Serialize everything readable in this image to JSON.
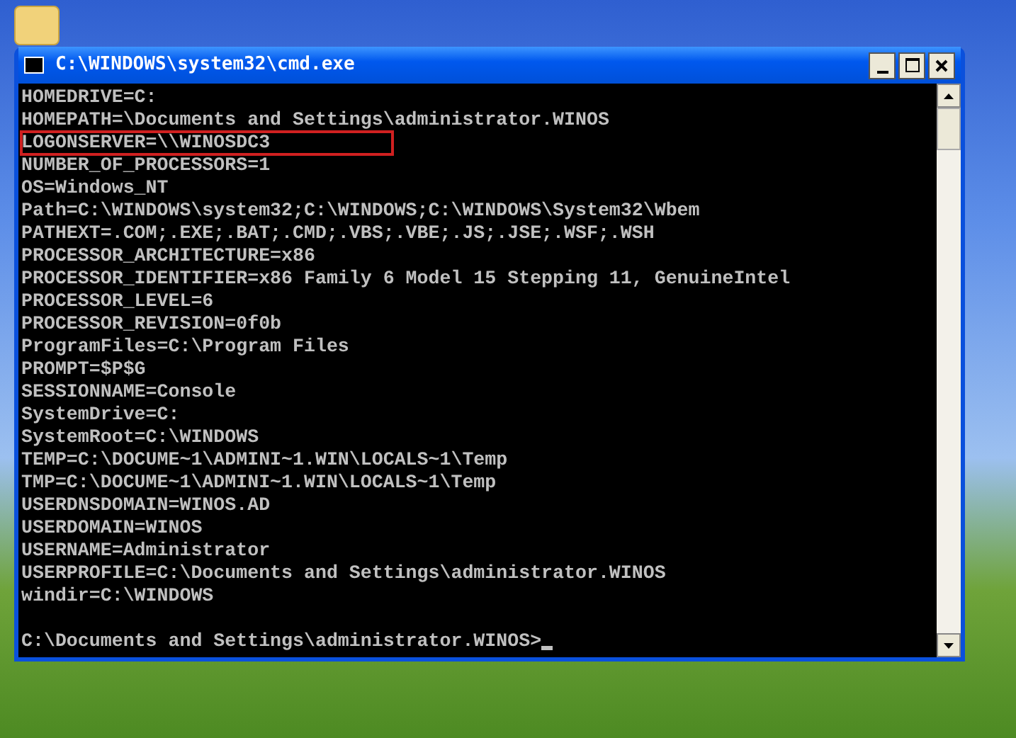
{
  "window": {
    "title": "C:\\WINDOWS\\system32\\cmd.exe"
  },
  "console": {
    "lines": [
      {
        "text": "HOMEDRIVE=C:",
        "boxed": false
      },
      {
        "text": "HOMEPATH=\\Documents and Settings\\administrator.WINOS",
        "boxed": false
      },
      {
        "text": "LOGONSERVER=\\\\WINOSDC3",
        "boxed": true
      },
      {
        "text": "NUMBER_OF_PROCESSORS=1",
        "boxed": false
      },
      {
        "text": "OS=Windows_NT",
        "boxed": false
      },
      {
        "text": "Path=C:\\WINDOWS\\system32;C:\\WINDOWS;C:\\WINDOWS\\System32\\Wbem",
        "boxed": false
      },
      {
        "text": "PATHEXT=.COM;.EXE;.BAT;.CMD;.VBS;.VBE;.JS;.JSE;.WSF;.WSH",
        "boxed": false
      },
      {
        "text": "PROCESSOR_ARCHITECTURE=x86",
        "boxed": false
      },
      {
        "text": "PROCESSOR_IDENTIFIER=x86 Family 6 Model 15 Stepping 11, GenuineIntel",
        "boxed": false
      },
      {
        "text": "PROCESSOR_LEVEL=6",
        "boxed": false
      },
      {
        "text": "PROCESSOR_REVISION=0f0b",
        "boxed": false
      },
      {
        "text": "ProgramFiles=C:\\Program Files",
        "boxed": false
      },
      {
        "text": "PROMPT=$P$G",
        "boxed": false
      },
      {
        "text": "SESSIONNAME=Console",
        "boxed": false
      },
      {
        "text": "SystemDrive=C:",
        "boxed": false
      },
      {
        "text": "SystemRoot=C:\\WINDOWS",
        "boxed": false
      },
      {
        "text": "TEMP=C:\\DOCUME~1\\ADMINI~1.WIN\\LOCALS~1\\Temp",
        "boxed": false
      },
      {
        "text": "TMP=C:\\DOCUME~1\\ADMINI~1.WIN\\LOCALS~1\\Temp",
        "boxed": false
      },
      {
        "text": "USERDNSDOMAIN=WINOS.AD",
        "boxed": false
      },
      {
        "text": "USERDOMAIN=WINOS",
        "boxed": false
      },
      {
        "text": "USERNAME=Administrator",
        "boxed": false
      },
      {
        "text": "USERPROFILE=C:\\Documents and Settings\\administrator.WINOS",
        "boxed": false
      },
      {
        "text": "windir=C:\\WINDOWS",
        "boxed": false
      }
    ],
    "prompt": "C:\\Documents and Settings\\administrator.WINOS>"
  }
}
